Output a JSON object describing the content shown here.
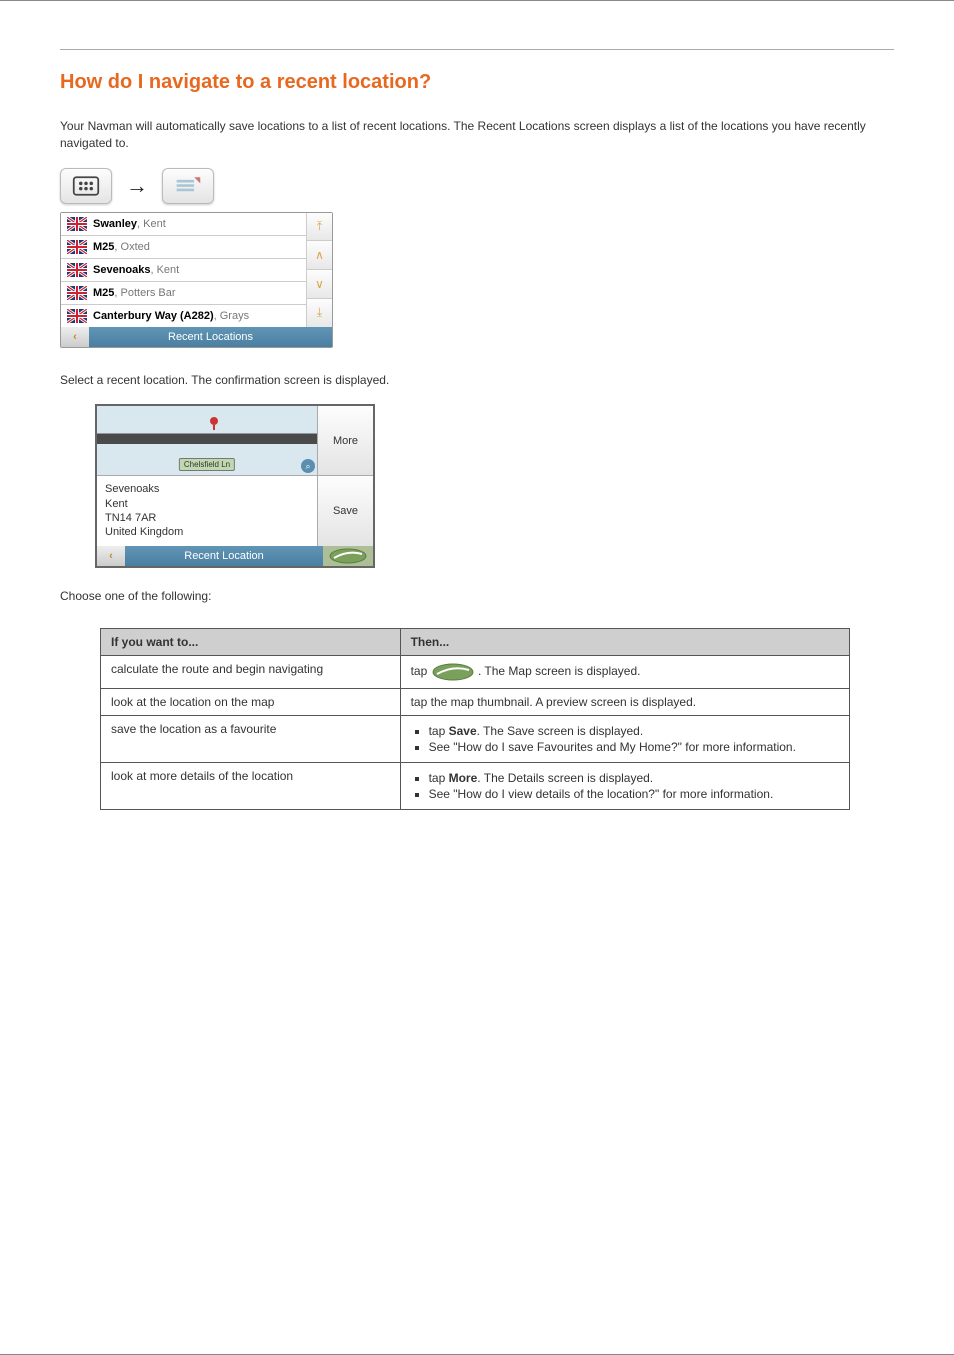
{
  "heading": "How do I navigate to a recent location?",
  "intro": "Your Navman will automatically save locations to a list of recent locations. The Recent Locations screen displays a list of the locations you have recently navigated to.",
  "breadcrumb_note": "Tap the Main Menu button, then the Recent Locations icon.",
  "list_screen": {
    "items": [
      {
        "name": "Swanley",
        "suffix": ", Kent"
      },
      {
        "name": "M25",
        "suffix": ", Oxted"
      },
      {
        "name": "Sevenoaks",
        "suffix": ", Kent"
      },
      {
        "name": "M25",
        "suffix": ", Potters Bar"
      },
      {
        "name": "Canterbury Way (A282)",
        "suffix": ", Grays"
      }
    ],
    "title": "Recent Locations"
  },
  "step_select": "Select a recent location. The confirmation screen is displayed.",
  "confirm_screen": {
    "map_label": "Chelsfield Ln",
    "addr_line1": "Sevenoaks",
    "addr_line2": "Kent",
    "addr_line3": "TN14 7AR",
    "addr_line4": "United Kingdom",
    "more": "More",
    "save": "Save",
    "title": "Recent Location"
  },
  "step_choose": "Choose one of the following:",
  "table": {
    "h1": "If you want to...",
    "h2": "Then...",
    "rows": [
      {
        "want": "calculate the route and begin navigating",
        "then_prefix": "tap ",
        "then_suffix": ". The Map screen is displayed."
      },
      {
        "want": "look at the location on the map",
        "then": "tap the map thumbnail. A preview screen is displayed."
      },
      {
        "want": "save the location as a favourite",
        "then_btn": "Save",
        "bullets": [
          ". The Save screen is displayed.",
          "See \"How do I save Favourites and My Home?\" for more information."
        ]
      },
      {
        "want": "look at more details of the location",
        "then_btn": "More",
        "bullets": [
          ". The Details screen is displayed.",
          "See \"How do I view details of the location?\" for more information."
        ]
      }
    ]
  }
}
